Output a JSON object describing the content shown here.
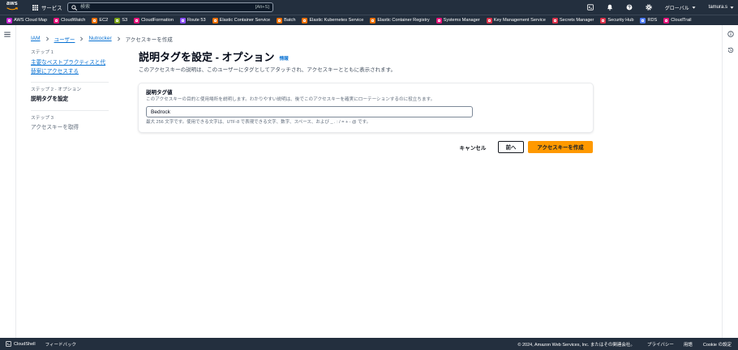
{
  "top_nav": {
    "logo_text": "aws",
    "services_label": "サービス",
    "search": {
      "placeholder": "検索",
      "shortcut": "[Alt+S]"
    },
    "icons": [
      "grid-icon",
      "search-icon",
      "cloudshell-icon",
      "bell-icon",
      "help-icon",
      "gear-icon"
    ],
    "region_label": "グローバル",
    "user_label": "tamura.s"
  },
  "favorites": [
    {
      "label": "AWS Cloud Map",
      "color": "#c925d1"
    },
    {
      "label": "CloudWatch",
      "color": "#e7157b"
    },
    {
      "label": "EC2",
      "color": "#ed7100"
    },
    {
      "label": "S3",
      "color": "#7aa116"
    },
    {
      "label": "CloudFormation",
      "color": "#e7157b"
    },
    {
      "label": "Route 53",
      "color": "#8c4fff"
    },
    {
      "label": "Elastic Container Service",
      "color": "#ed7100"
    },
    {
      "label": "Batch",
      "color": "#ed7100"
    },
    {
      "label": "Elastic Kubernetes Service",
      "color": "#ed7100"
    },
    {
      "label": "Elastic Container Registry",
      "color": "#ed7100"
    },
    {
      "label": "Systems Manager",
      "color": "#e7157b"
    },
    {
      "label": "Key Management Service",
      "color": "#dd344c"
    },
    {
      "label": "Secrets Manager",
      "color": "#dd344c"
    },
    {
      "label": "Security Hub",
      "color": "#dd344c"
    },
    {
      "label": "RDS",
      "color": "#527fff"
    },
    {
      "label": "CloudTrail",
      "color": "#e7157b"
    }
  ],
  "breadcrumb": [
    {
      "label": "IAM",
      "is_link": true
    },
    {
      "label": "ユーザー",
      "is_link": true
    },
    {
      "label": "Nutrocker",
      "is_link": true
    },
    {
      "label": "アクセスキーを作成",
      "is_link": false
    }
  ],
  "steps": [
    {
      "step_label": "ステップ 1",
      "title": "主要なベストプラクティスと代替案にアクセスする",
      "is_current": false
    },
    {
      "step_label": "ステップ 2 - オプション",
      "title": "説明タグを設定",
      "is_current": true
    },
    {
      "step_label": "ステップ 3",
      "title": "アクセスキーを取得",
      "is_current": false
    }
  ],
  "page": {
    "title": "説明タグを設定 - オプション",
    "info_link": "情報",
    "description": "このアクセスキーの説明は、このユーザーにタグとしてアタッチされ、アクセスキーとともに表示されます。"
  },
  "form": {
    "label": "説明タグ値",
    "description": "このアクセスキーの目的と使用場所を説明します。わかりやすい説明は、後でこのアクセスキーを確実にローテーションするのに役立ちます。",
    "value": "Bedrock",
    "constraint": "最大 256 文字です。使用できる文字は、UTF-8 で表現できる文字、数字、スペース、および _ . : / = + - @ です。"
  },
  "actions": {
    "cancel": "キャンセル",
    "previous": "前へ",
    "submit": "アクセスキーを作成"
  },
  "footer": {
    "cloudshell": "CloudShell",
    "feedback": "フィードバック",
    "copyright": "© 2024, Amazon Web Services, Inc. またはその関連会社。",
    "privacy": "プライバシー",
    "terms": "用語",
    "cookies": "Cookie の設定"
  },
  "colors": {
    "nav_bg": "#232f3e",
    "link": "#0972d3",
    "primary_button": "#ff9900",
    "logo_smile": "#ff9900",
    "text": "#000716",
    "muted": "#5f6b7a"
  }
}
